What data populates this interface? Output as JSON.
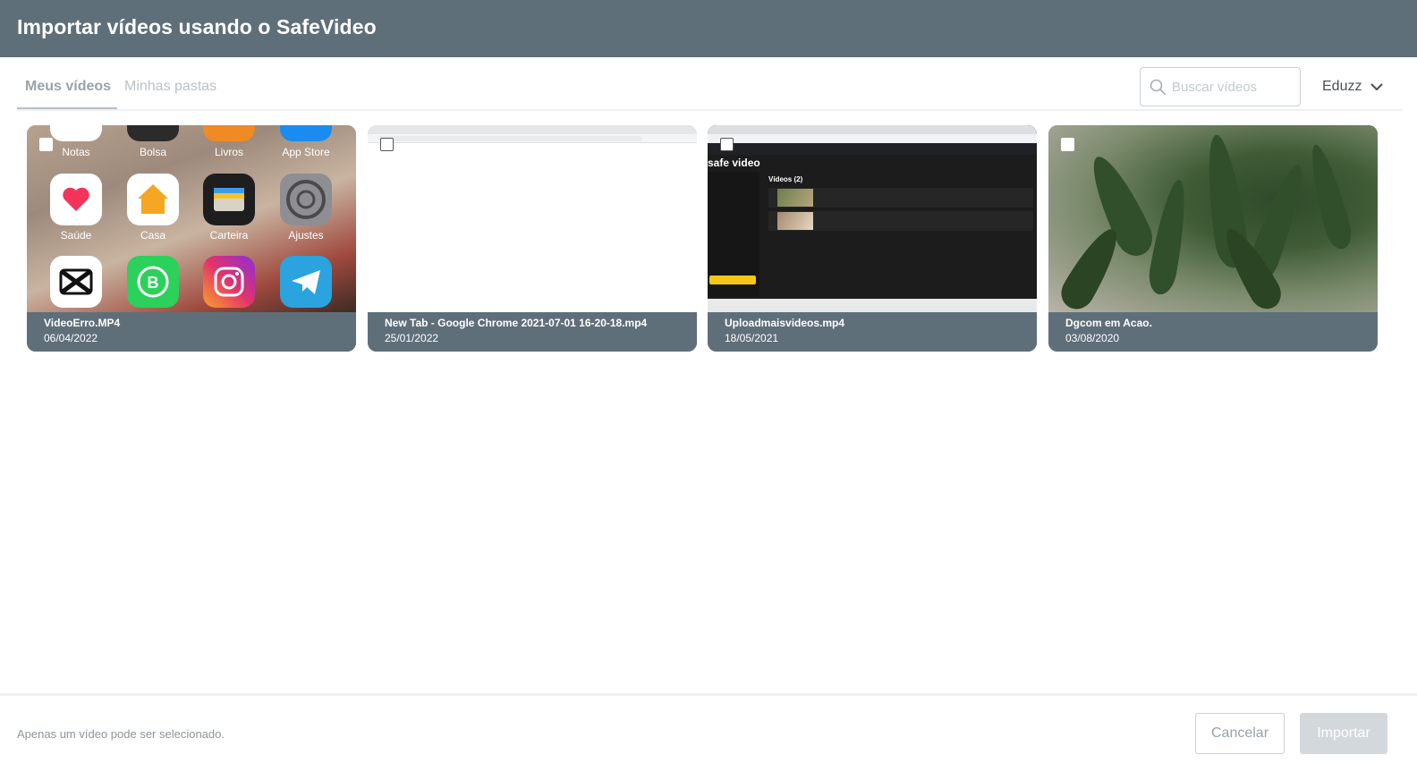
{
  "header": {
    "title": "Importar vídeos usando o SafeVideo"
  },
  "tabs": [
    {
      "label": "Meus vídeos",
      "active": true
    },
    {
      "label": "Minhas pastas",
      "active": false
    }
  ],
  "search": {
    "placeholder": "Buscar vídeos",
    "value": ""
  },
  "account": {
    "name": "Eduzz",
    "icon": "chevron-down-icon"
  },
  "videos": [
    {
      "title": "VideoErro.MP4",
      "date": "06/04/2022"
    },
    {
      "title": "New Tab - Google Chrome 2021-07-01 16-20-18.mp4",
      "date": "25/01/2022"
    },
    {
      "title": "Uploadmaisvideos.mp4",
      "date": "18/05/2021"
    },
    {
      "title": "Dgcom em Acao.",
      "date": "03/08/2020"
    }
  ],
  "thumb1_apps": {
    "row1": [
      "Notas",
      "Bolsa",
      "Livros",
      "App Store"
    ],
    "row2": [
      "Saúde",
      "Casa",
      "Carteira",
      "Ajustes"
    ]
  },
  "thumb3": {
    "logo": "safe video",
    "heading": "Vídeos (2)"
  },
  "footer": {
    "note": "Apenas um vídeo pode ser selecionado.",
    "cancel_label": "Cancelar",
    "import_label": "Importar"
  },
  "colors": {
    "header_bg": "#5f6f7a",
    "card_info_bg": "#5f6f7a",
    "import_disabled": "#d3d8dc"
  }
}
